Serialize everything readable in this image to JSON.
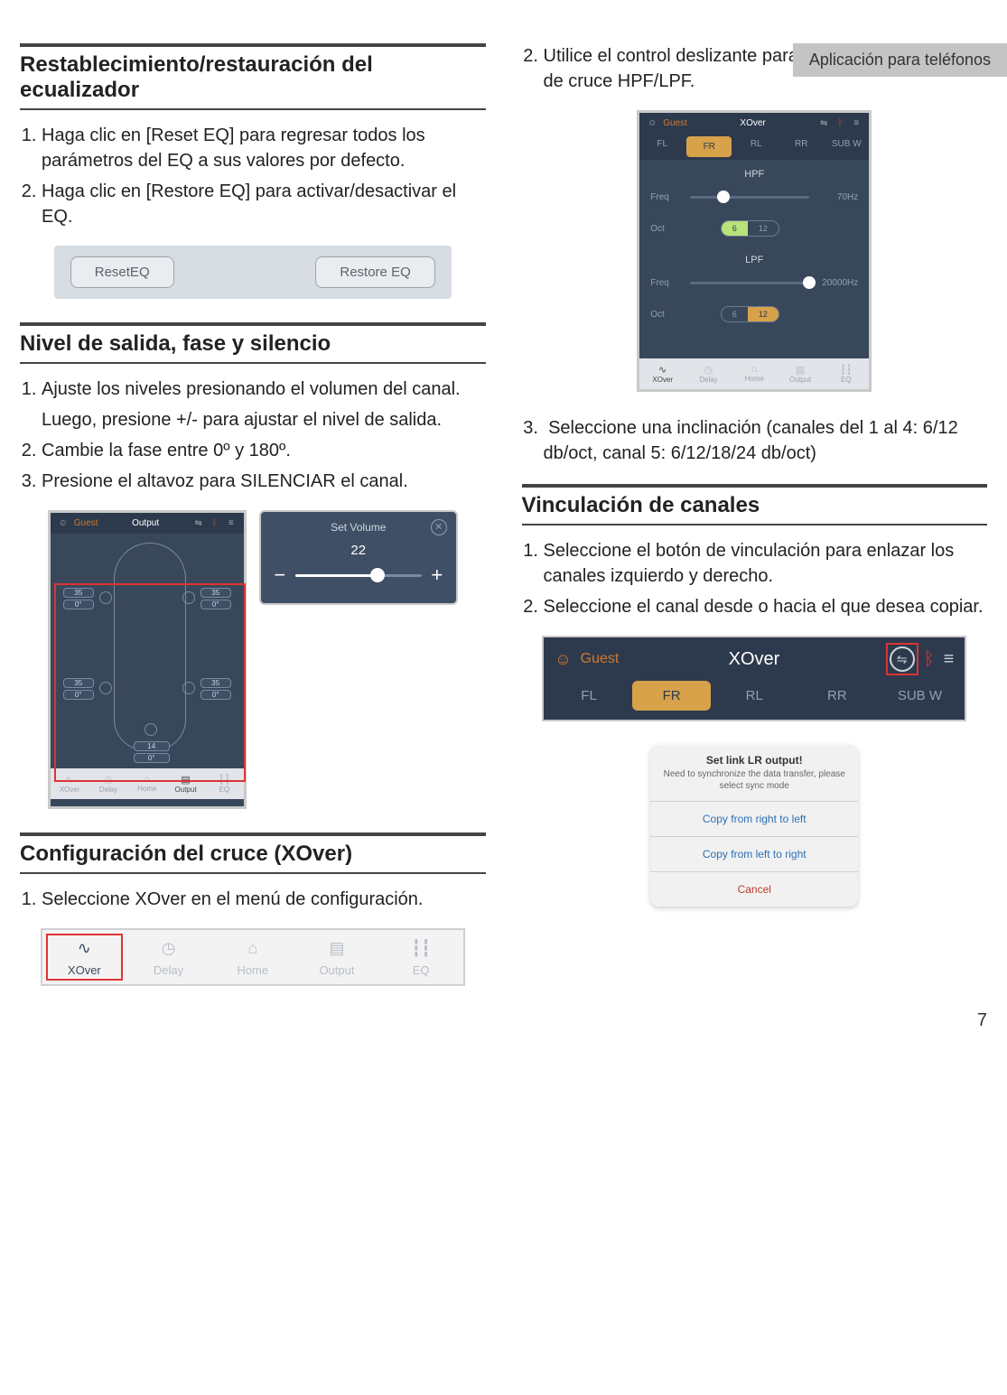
{
  "header_tab": "Aplicación para teléfonos",
  "page_number": "7",
  "left": {
    "sec1": {
      "title": "Restablecimiento/restauración del ecualizador",
      "steps": [
        "Haga clic en [Reset EQ] para regresar todos los parámetros del EQ a sus valores por defecto.",
        "Haga clic en [Restore EQ] para activar/desactivar el EQ."
      ],
      "eq_strip": {
        "reset": "ResetEQ",
        "restore": "Restore EQ"
      }
    },
    "sec2": {
      "title": "Nivel de salida, fase y silencio",
      "steps": [
        {
          "main": "Ajuste los niveles presionando el volumen del canal.",
          "sub": "Luego, presione +/- para ajustar el nivel de salida."
        },
        {
          "main": "Cambie la fase entre 0º y 180º."
        },
        {
          "main": "Presione el altavoz para SILENCIAR el canal."
        }
      ],
      "output_shot": {
        "topbar": {
          "user": "Guest",
          "title": "Output"
        },
        "speakers": {
          "fl": {
            "vol": "35",
            "phase": "0°"
          },
          "fr": {
            "vol": "35",
            "phase": "0°"
          },
          "rl": {
            "vol": "35",
            "phase": "0°"
          },
          "rr": {
            "vol": "35",
            "phase": "0°"
          },
          "sub": {
            "vol": "14",
            "phase": "0°"
          }
        },
        "bottom": {
          "xover": "XOver",
          "delay": "Delay",
          "home": "Home",
          "output": "Output",
          "eq": "EQ"
        }
      },
      "setvol": {
        "title": "Set Volume",
        "value": "22",
        "minus": "−",
        "plus": "+"
      }
    },
    "sec3": {
      "title": "Configuración del cruce (XOver)",
      "steps": [
        "Seleccione XOver en el menú de configuración."
      ],
      "nav": {
        "xover": "XOver",
        "delay": "Delay",
        "home": "Home",
        "output": "Output",
        "eq": "EQ"
      }
    }
  },
  "right": {
    "cont_steps": {
      "s2": "Utilice el control deslizante para cambiar la frecuencia de cruce HPF/LPF.",
      "s3": "Seleccione una inclinación (canales del 1 al 4: 6/12 db/oct, canal 5: 6/12/18/24 db/oct)"
    },
    "xover_shot": {
      "topbar": {
        "user": "Guest",
        "title": "XOver"
      },
      "tabs": {
        "fl": "FL",
        "fr": "FR",
        "rl": "RL",
        "rr": "RR",
        "sub": "SUB W"
      },
      "hpf": {
        "label": "HPF",
        "freq_label": "Freq",
        "freq_val": "70Hz",
        "oct_label": "Oct",
        "seg": [
          "6",
          "12"
        ]
      },
      "lpf": {
        "label": "LPF",
        "freq_label": "Freq",
        "freq_val": "20000Hz",
        "oct_label": "Oct",
        "seg": [
          "6",
          "12"
        ]
      },
      "bottom": {
        "xover": "XOver",
        "delay": "Delay",
        "home": "Home",
        "output": "Output",
        "eq": "EQ"
      }
    },
    "sec_link": {
      "title": "Vinculación de canales",
      "steps": [
        "Seleccione el botón de vinculación para enlazar los canales izquierdo y derecho.",
        "Seleccione el canal desde o hacia el que desea copiar."
      ],
      "header_shot": {
        "user": "Guest",
        "title": "XOver",
        "tabs": {
          "fl": "FL",
          "fr": "FR",
          "rl": "RL",
          "rr": "RR",
          "sub": "SUB W"
        }
      },
      "dialog": {
        "title": "Set link LR output!",
        "subtitle": "Need to synchronize the data transfer, please select sync mode",
        "opt1": "Copy from right to left",
        "opt2": "Copy from left to right",
        "cancel": "Cancel"
      }
    }
  }
}
